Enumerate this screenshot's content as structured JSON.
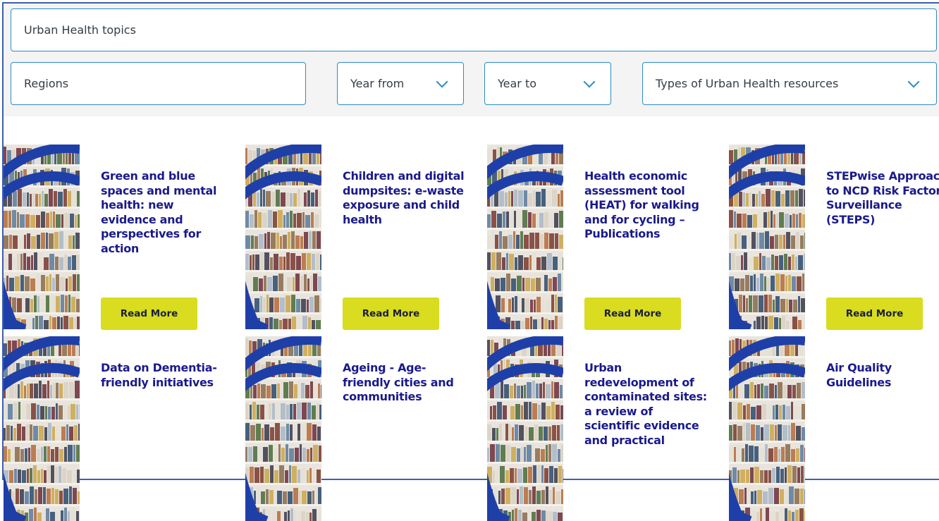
{
  "filters": {
    "topics_placeholder": "Urban Health topics",
    "regions_placeholder": "Regions",
    "year_from_label": "Year from",
    "year_to_label": "Year to",
    "types_label": "Types of Urban Health resources"
  },
  "colors": {
    "accent": "#2b8cc4",
    "title": "#1a1a8c",
    "button": "#d9dc1f",
    "thumb_arc": "#1f3fa8"
  },
  "cards": [
    {
      "title": "Green and blue spaces and mental health: new evidence and perspectives for action",
      "button": "Read More"
    },
    {
      "title": "Children and digital dumpsites: e-waste exposure and child health",
      "button": "Read More"
    },
    {
      "title": "Health economic assessment tool (HEAT) for walking and for cycling – Publications",
      "button": "Read More"
    },
    {
      "title": "STEPwise Approach to NCD Risk Factor Surveillance (STEPS)",
      "button": "Read More"
    },
    {
      "title": "Data on Dementia-friendly initiatives"
    },
    {
      "title": "Ageing - Age-friendly cities and communities"
    },
    {
      "title": "Urban redevelopment of contaminated sites: a review of scientific evidence and practical"
    },
    {
      "title": "Air Quality Guidelines"
    }
  ]
}
